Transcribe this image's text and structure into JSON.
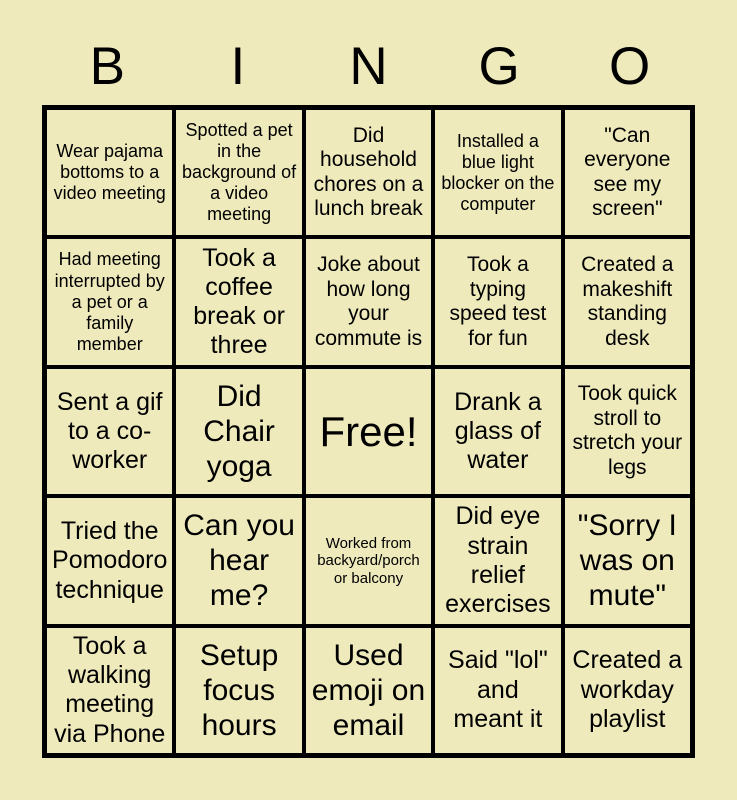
{
  "title": "BINGO",
  "colors": {
    "background": "#eeeabc",
    "cell_background": "#eeeabc",
    "grid_line": "#000000",
    "text": "#000000"
  },
  "header": {
    "letters": [
      "B",
      "I",
      "N",
      "G",
      "O"
    ]
  },
  "grid": {
    "rows": 5,
    "columns": 5,
    "free_space": {
      "row": 2,
      "column": 2,
      "label": "Free!"
    },
    "cells": [
      {
        "text": "Wear pajama bottoms to a video meeting",
        "size": "s"
      },
      {
        "text": "Spotted a pet in the background of a video meeting",
        "size": "s"
      },
      {
        "text": "Did household chores on a lunch break",
        "size": "m"
      },
      {
        "text": "Installed a blue light blocker on the computer",
        "size": "s"
      },
      {
        "text": "\"Can everyone see my screen\"",
        "size": "m"
      },
      {
        "text": "Had meeting interrupted by a pet or a family member",
        "size": "s"
      },
      {
        "text": "Took a coffee break or three",
        "size": "l"
      },
      {
        "text": "Joke about how long your commute is",
        "size": "m"
      },
      {
        "text": "Took a typing speed test for fun",
        "size": "m"
      },
      {
        "text": "Created a makeshift standing desk",
        "size": "m"
      },
      {
        "text": "Sent a gif to a co-worker",
        "size": "l"
      },
      {
        "text": "Did Chair yoga",
        "size": "xl"
      },
      {
        "text": "Free!",
        "size": "free"
      },
      {
        "text": "Drank a glass of water",
        "size": "l"
      },
      {
        "text": "Took quick stroll to stretch your legs",
        "size": "m"
      },
      {
        "text": "Tried the Pomodoro technique",
        "size": "l"
      },
      {
        "text": "Can you hear me?",
        "size": "xl"
      },
      {
        "text": "Worked from backyard/porch or balcony",
        "size": "xs"
      },
      {
        "text": "Did eye strain relief exercises",
        "size": "l"
      },
      {
        "text": "\"Sorry I was on mute\"",
        "size": "xl"
      },
      {
        "text": "Took a walking meeting via Phone",
        "size": "l"
      },
      {
        "text": "Setup focus hours",
        "size": "xl"
      },
      {
        "text": "Used emoji on email",
        "size": "xl"
      },
      {
        "text": "Said \"lol\" and meant it",
        "size": "l"
      },
      {
        "text": "Created a workday playlist",
        "size": "l"
      }
    ]
  }
}
